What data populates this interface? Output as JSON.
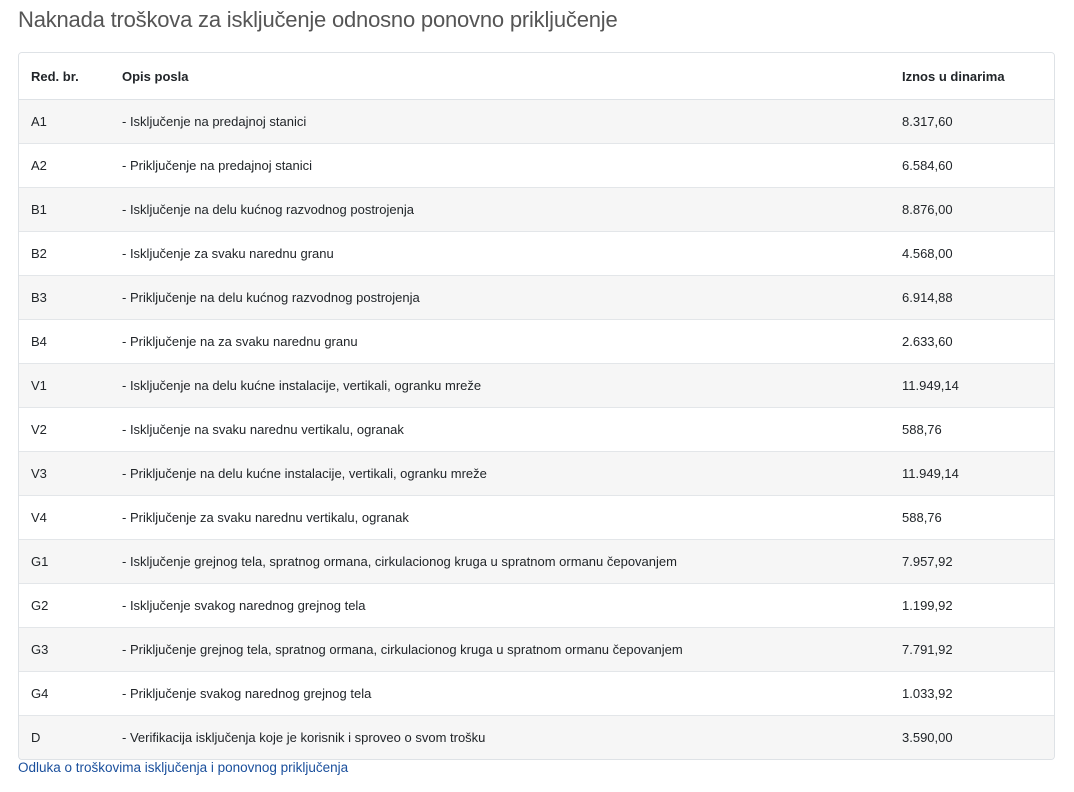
{
  "page_title": "Naknada troškova za isključenje odnosno ponovno priključenje",
  "table": {
    "headers": [
      "Red. br.",
      "Opis posla",
      "Iznos u dinarima"
    ],
    "rows": [
      {
        "code": "A1",
        "description": "- Isključenje na predajnoj stanici",
        "amount": "8.317,60"
      },
      {
        "code": "A2",
        "description": "- Priključenje na predajnoj stanici",
        "amount": "6.584,60"
      },
      {
        "code": "B1",
        "description": "- Isključenje na delu kućnog razvodnog postrojenja",
        "amount": "8.876,00"
      },
      {
        "code": "B2",
        "description": "- Isključenje za svaku narednu granu",
        "amount": "4.568,00"
      },
      {
        "code": "B3",
        "description": "- Priključenje na delu kućnog razvodnog postrojenja",
        "amount": "6.914,88"
      },
      {
        "code": "B4",
        "description": "- Priključenje na za svaku narednu granu",
        "amount": "2.633,60"
      },
      {
        "code": "V1",
        "description": "- Isključenje na delu kućne instalacije, vertikali, ogranku mreže",
        "amount": "11.949,14"
      },
      {
        "code": "V2",
        "description": "- Isključenje na svaku narednu vertikalu, ogranak",
        "amount": "588,76"
      },
      {
        "code": "V3",
        "description": "- Priključenje na delu kućne instalacije, vertikali, ogranku mreže",
        "amount": "11.949,14"
      },
      {
        "code": "V4",
        "description": "- Priključenje za svaku narednu vertikalu, ogranak",
        "amount": "588,76"
      },
      {
        "code": "G1",
        "description": "- Isključenje grejnog tela, spratnog ormana, cirkulacionog kruga u spratnom ormanu čepovanjem",
        "amount": "7.957,92"
      },
      {
        "code": "G2",
        "description": "- Isključenje svakog narednog grejnog tela",
        "amount": "1.199,92"
      },
      {
        "code": "G3",
        "description": "- Priključenje grejnog tela, spratnog ormana, cirkulacionog kruga u spratnom ormanu čepovanjem",
        "amount": "7.791,92"
      },
      {
        "code": "G4",
        "description": "- Priključenje svakog narednog grejnog tela",
        "amount": "1.033,92"
      },
      {
        "code": "D",
        "description": "- Verifikacija isključenja koje je korisnik i sproveo o svom trošku",
        "amount": "3.590,00"
      }
    ]
  },
  "footer_link": "Odluka o troškovima isključenja i ponovnog priključenja",
  "colors": {
    "title": "#555555",
    "link": "#1a4f9c",
    "stripe": "#f6f6f6",
    "border": "#dee2e6"
  }
}
